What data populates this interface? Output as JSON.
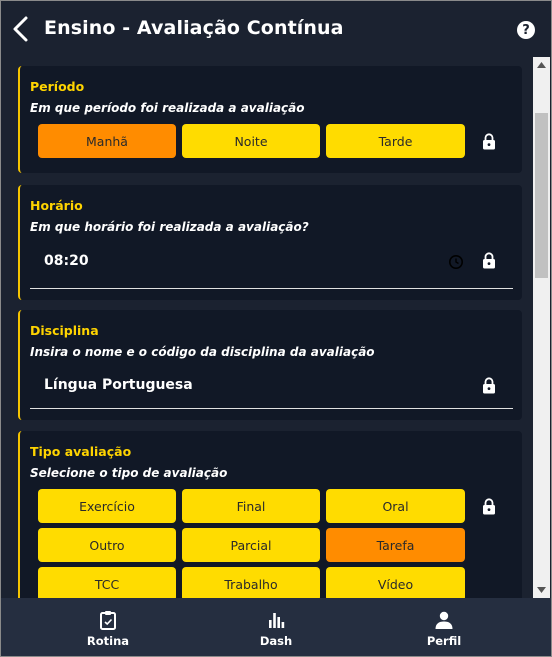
{
  "header": {
    "title": "Ensino - Avaliação Contínua",
    "help": "?"
  },
  "periodo": {
    "title": "Período",
    "subtitle": "Em que período foi realizada a avaliação",
    "options": [
      "Manhã",
      "Noite",
      "Tarde"
    ],
    "selected": "Manhã"
  },
  "horario": {
    "title": "Horário",
    "subtitle": "Em que horário foi realizada a avaliação?",
    "value": "08:20"
  },
  "disciplina": {
    "title": "Disciplina",
    "subtitle": "Insira o nome e o código da disciplina da avaliação",
    "value": "Língua Portuguesa"
  },
  "tipo": {
    "title": "Tipo avaliação",
    "subtitle": "Selecione o tipo de avaliação",
    "options": [
      "Exercício",
      "Final",
      "Oral",
      "Outro",
      "Parcial",
      "Tarefa",
      "TCC",
      "Trabalho",
      "Vídeo"
    ],
    "selected": "Tarefa"
  },
  "nav": {
    "items": [
      "Rotina",
      "Dash",
      "Perfil"
    ]
  },
  "colors": {
    "background": "#1b2230",
    "card": "#111826",
    "accent": "#ffd400",
    "option": "#ffdc00",
    "option_selected": "#ff8c00",
    "nav": "#252e40"
  },
  "icons": {
    "back": "chevron-left-icon",
    "help": "help-circle-icon",
    "lock": "lock-icon",
    "clock": "clock-icon",
    "rotina": "clipboard-icon",
    "dash": "bar-chart-icon",
    "perfil": "person-icon"
  }
}
